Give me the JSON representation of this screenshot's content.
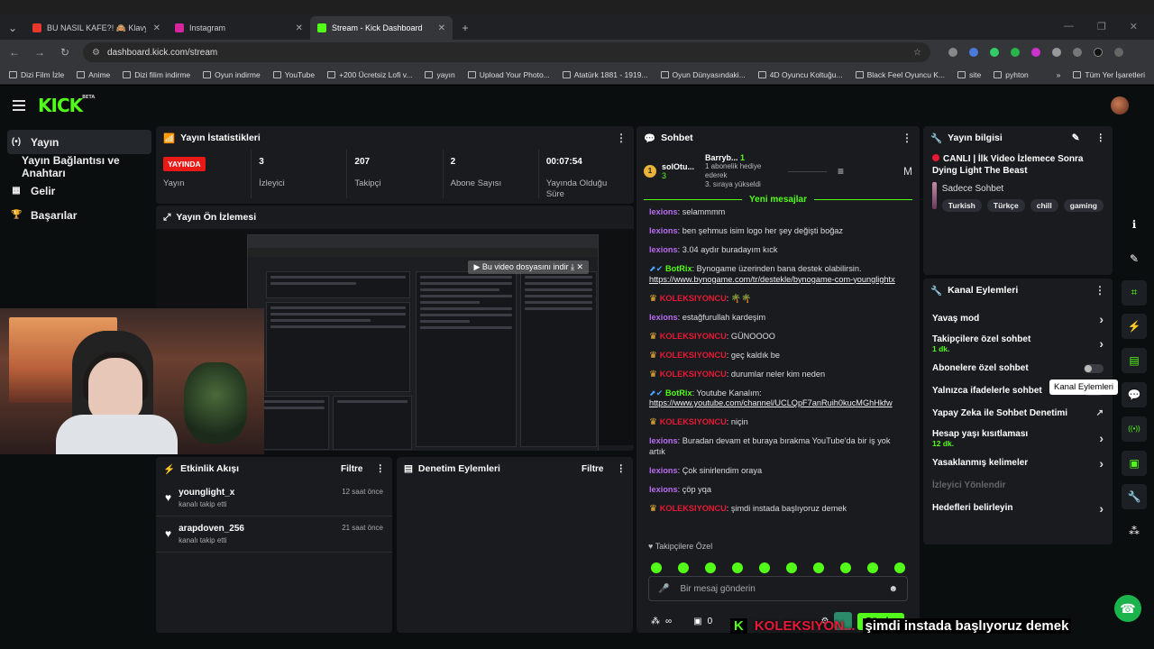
{
  "browser": {
    "tabs": [
      {
        "label": "BU NASIL KAFE?! 🙈 Klavyeler",
        "color": "#e8382c",
        "active": false
      },
      {
        "label": "Instagram",
        "color": "#d6249f",
        "active": false
      },
      {
        "label": "Stream - Kick Dashboard",
        "color": "#53fc18",
        "active": true
      }
    ],
    "url": "dashboard.kick.com/stream",
    "bookmarks": [
      "Dizi Film İzle",
      "Anime",
      "Dizi filim indirme",
      "Oyun indirme",
      "YouTube",
      "+200 Ücretsiz Lofi v...",
      "yayın",
      "Upload Your Photo...",
      "Atatürk 1881 - 1919...",
      "Oyun Dünyasındaki...",
      "4D Oyuncu Koltuğu...",
      "Black Feel Oyuncu K...",
      "site",
      "pyhton"
    ],
    "all_bookmarks": "Tüm Yer İşaretleri"
  },
  "app": {
    "logo": "KICK",
    "logo_sup": "BETA",
    "sidebar": [
      {
        "label": "Yayın",
        "icon": "broadcast-icon",
        "glyph": "(•)",
        "active": true,
        "sub": false
      },
      {
        "label": "Yayın Bağlantısı ve Anahtarı",
        "icon": "",
        "glyph": "",
        "active": false,
        "sub": true
      },
      {
        "label": "Gelir",
        "icon": "chart-icon",
        "glyph": "▦",
        "active": false,
        "sub": false
      },
      {
        "label": "Başarılar",
        "icon": "trophy-icon",
        "glyph": "🏆",
        "active": false,
        "sub": false
      }
    ]
  },
  "stats": {
    "title": "Yayın İstatistikleri",
    "live_badge": "YAYINDA",
    "items": [
      {
        "value": "",
        "label": "Yayın"
      },
      {
        "value": "3",
        "label": "İzleyici"
      },
      {
        "value": "207",
        "label": "Takipçi"
      },
      {
        "value": "2",
        "label": "Abone Sayısı"
      },
      {
        "value": "00:07:54",
        "label": "Yayında Olduğu Süre"
      }
    ]
  },
  "preview": {
    "title": "Yayın Ön İzlemesi",
    "download_overlay": "Bu video dosyasını indir"
  },
  "activity": {
    "title": "Etkinlik Akışı",
    "filter": "Filtre",
    "items": [
      {
        "user": "younglight_x",
        "action": "kanalı takip etti",
        "time": "12 saat önce"
      },
      {
        "user": "arapdoven_256",
        "action": "kanalı takip etti",
        "time": "21 saat önce"
      }
    ]
  },
  "moderation": {
    "title": "Denetim Eylemleri",
    "filter": "Filtre"
  },
  "chat": {
    "title": "Sohbet",
    "top_user": "solOtu...",
    "top_count": "3",
    "gift_user": "Barryb...",
    "gift_count": "1",
    "gift_text": "1 abonelik hediye ederek",
    "gift_rank": "3. sıraya yükseldi",
    "top_m": "M",
    "new_messages": "Yeni mesajlar",
    "messages": [
      {
        "user": "lexions",
        "type": "u1",
        "badge": "",
        "text": "selammmm",
        "link": ""
      },
      {
        "user": "lexions",
        "type": "u1",
        "badge": "",
        "text": "ben şehmus isim logo her şey değişti boğaz",
        "link": ""
      },
      {
        "user": "lexions",
        "type": "u1",
        "badge": "",
        "text": "3.04 aydır buradayım kıck",
        "link": ""
      },
      {
        "user": "BotRix",
        "type": "u3",
        "badge": "bot",
        "text": "Bynogame üzerinden bana destek olabilirsin.",
        "link": "https://www.bynogame.com/tr/destekle/bynogame-com-younglightx"
      },
      {
        "user": "KOLEKSIYONCU",
        "type": "u2",
        "badge": "crown",
        "text": "🌴🌴",
        "link": ""
      },
      {
        "user": "lexions",
        "type": "u1",
        "badge": "",
        "text": "estağfurullah kardeşim",
        "link": ""
      },
      {
        "user": "KOLEKSIYONCU",
        "type": "u2",
        "badge": "crown",
        "text": "GÜNOOOO",
        "link": ""
      },
      {
        "user": "KOLEKSIYONCU",
        "type": "u2",
        "badge": "crown",
        "text": "geç kaldık be",
        "link": ""
      },
      {
        "user": "KOLEKSIYONCU",
        "type": "u2",
        "badge": "crown",
        "text": "durumlar neler kim neden",
        "link": ""
      },
      {
        "user": "BotRix",
        "type": "u3",
        "badge": "bot",
        "text": "Youtube Kanalım:",
        "link": "https://www.youtube.com/channel/UCLQpF7anRuih0kucMGhHkfw"
      },
      {
        "user": "KOLEKSIYONCU",
        "type": "u2",
        "badge": "crown",
        "text": "niçin",
        "link": ""
      },
      {
        "user": "lexions",
        "type": "u1",
        "badge": "",
        "text": "Buradan devam et buraya bırakma YouTube'da bir iş yok artık",
        "link": ""
      },
      {
        "user": "lexions",
        "type": "u1",
        "badge": "",
        "text": "Çok sinirlendim oraya",
        "link": ""
      },
      {
        "user": "lexions",
        "type": "u1",
        "badge": "",
        "text": "çöp yqa",
        "link": ""
      },
      {
        "user": "KOLEKSIYONCU",
        "type": "u2",
        "badge": "crown",
        "text": "şimdi instada başlıyoruz demek",
        "link": ""
      }
    ],
    "followers_only": "Takipçilere Özel",
    "input_placeholder": "Bir mesaj gönderin",
    "bottom_count1": "∞",
    "bottom_count2": "0",
    "send": "Gönder"
  },
  "stream_info": {
    "title": "Yayın bilgisi",
    "stream_title": "CANLI | İlk Video İzlemece Sonra Dying Light The Beast",
    "category": "Sadece Sohbet",
    "tags": [
      "Turkish",
      "Türkçe",
      "chill",
      "gaming"
    ]
  },
  "channel_actions": {
    "title": "Kanal Eylemleri",
    "items": [
      {
        "label": "Yavaş mod",
        "sub": "",
        "control": "arrow"
      },
      {
        "label": "Takipçilere özel sohbet",
        "sub": "1 dk.",
        "control": "arrow"
      },
      {
        "label": "Abonelere özel sohbet",
        "sub": "",
        "control": "toggle"
      },
      {
        "label": "Yalnızca ifadelerle sohbet",
        "sub": "",
        "control": "toggle"
      },
      {
        "label": "Yapay Zeka ile Sohbet Denetimi",
        "sub": "",
        "control": "external"
      },
      {
        "label": "Hesap yaşı kısıtlaması",
        "sub": "12 dk.",
        "control": "arrow"
      },
      {
        "label": "Yasaklanmış kelimeler",
        "sub": "",
        "control": "arrow"
      },
      {
        "label": "İzleyici Yönlendir",
        "sub": "",
        "control": "none"
      },
      {
        "label": "Hedefleri belirleyin",
        "sub": "",
        "control": "arrow"
      }
    ],
    "tooltip": "Kanal Eylemleri"
  },
  "rail": [
    "info-icon",
    "edit-icon",
    "capture-icon",
    "bolt-icon",
    "document-icon",
    "chat-icon",
    "broadcast-icon",
    "channel-actions-icon",
    "wrench-icon",
    "share-icon"
  ],
  "caption": {
    "user": "KOLEKSIYON...",
    "text": "şimdi instada başlıyoruz demek"
  }
}
